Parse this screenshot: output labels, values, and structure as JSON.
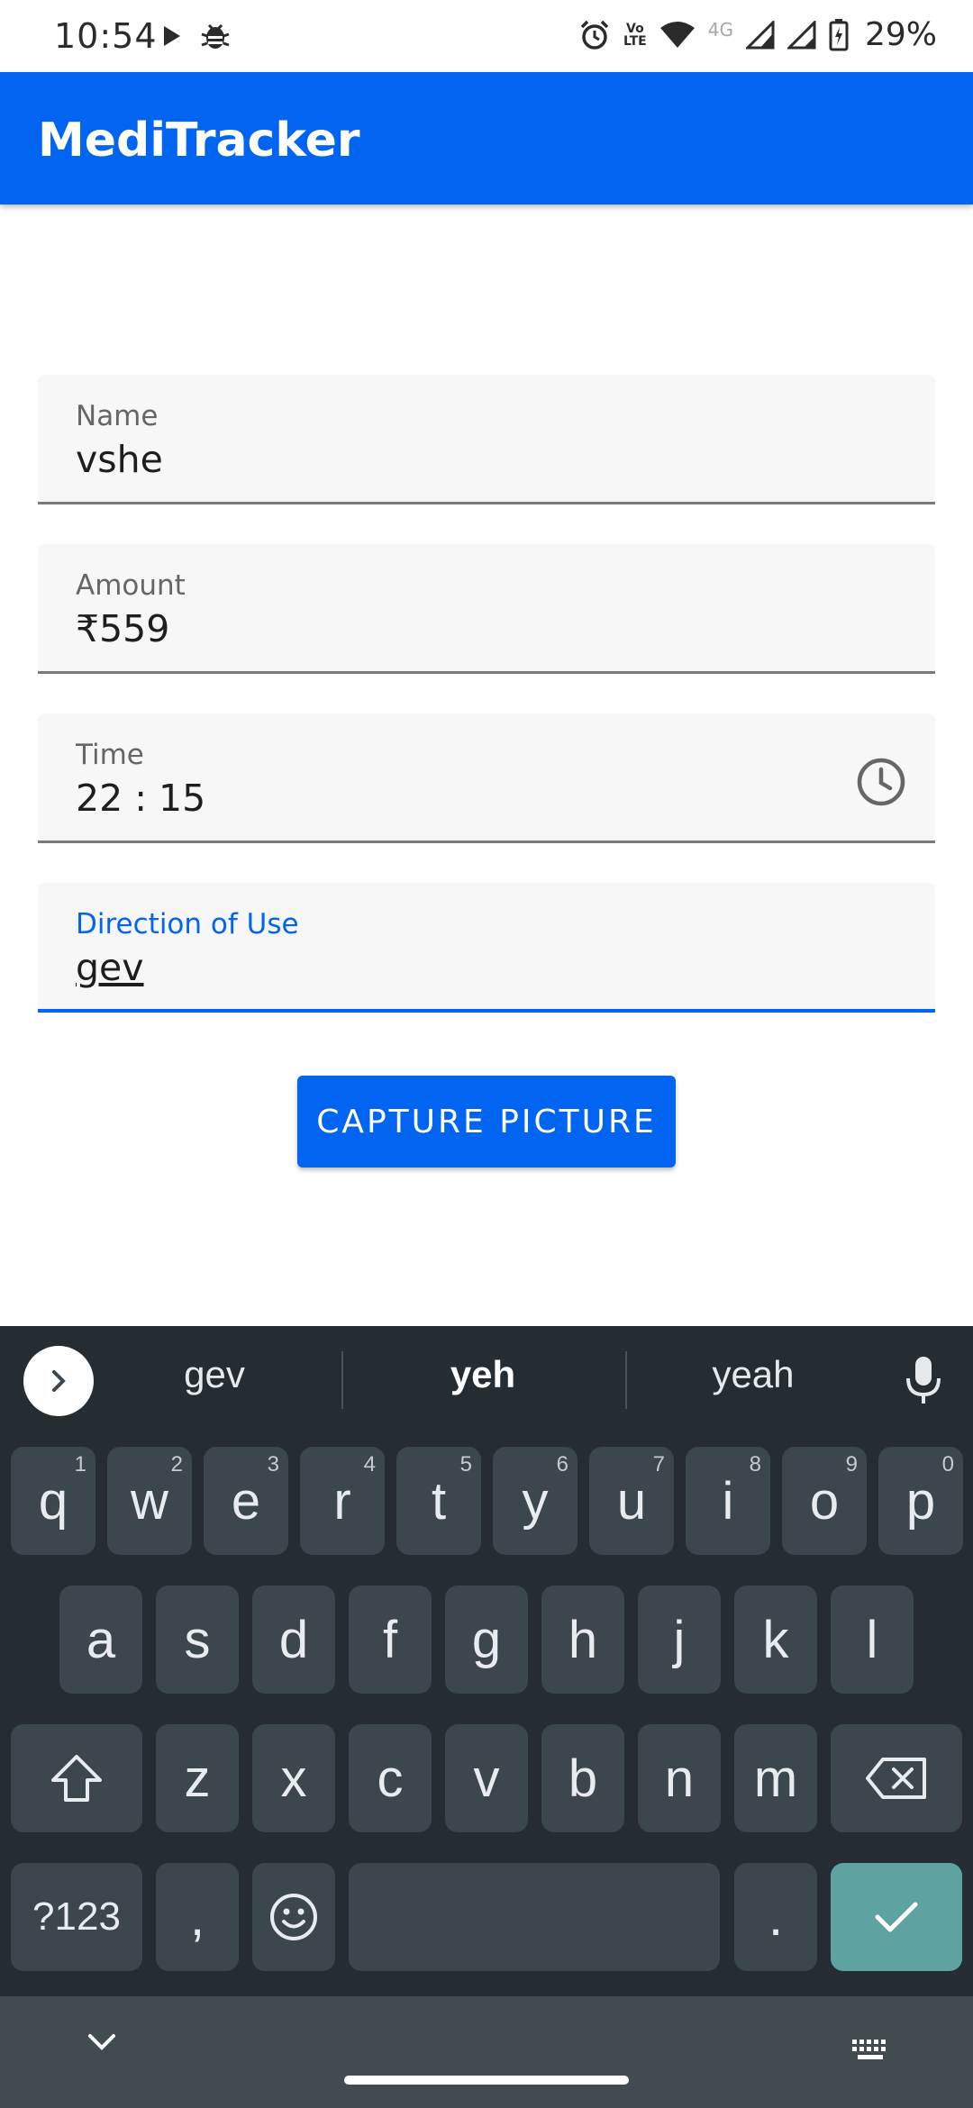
{
  "status_bar": {
    "time": "10:54",
    "battery_percent": "29%",
    "network_type": "4G",
    "volte_line1": "Vo",
    "volte_line2": "LTE"
  },
  "app_bar": {
    "title": "MediTracker"
  },
  "form": {
    "name": {
      "label": "Name",
      "value": "vshe"
    },
    "amount": {
      "label": "Amount",
      "value": "₹559"
    },
    "time": {
      "label": "Time",
      "value": "22 : 15"
    },
    "direction": {
      "label": "Direction of Use",
      "value": "gev"
    }
  },
  "capture_button": {
    "label": "CAPTURE PICTURE"
  },
  "keyboard": {
    "suggestions": [
      "gev",
      "yeh",
      "yeah"
    ],
    "row1": [
      {
        "key": "q",
        "hint": "1"
      },
      {
        "key": "w",
        "hint": "2"
      },
      {
        "key": "e",
        "hint": "3"
      },
      {
        "key": "r",
        "hint": "4"
      },
      {
        "key": "t",
        "hint": "5"
      },
      {
        "key": "y",
        "hint": "6"
      },
      {
        "key": "u",
        "hint": "7"
      },
      {
        "key": "i",
        "hint": "8"
      },
      {
        "key": "o",
        "hint": "9"
      },
      {
        "key": "p",
        "hint": "0"
      }
    ],
    "row2": [
      "a",
      "s",
      "d",
      "f",
      "g",
      "h",
      "j",
      "k",
      "l"
    ],
    "row3": [
      "z",
      "x",
      "c",
      "v",
      "b",
      "n",
      "m"
    ],
    "symbols_label": "?123",
    "comma": ",",
    "period": "."
  },
  "colors": {
    "primary": "#0165f2",
    "keyboard_bg": "#252d33",
    "key_bg": "#3c464d",
    "enter_key": "#5fa3a0"
  }
}
